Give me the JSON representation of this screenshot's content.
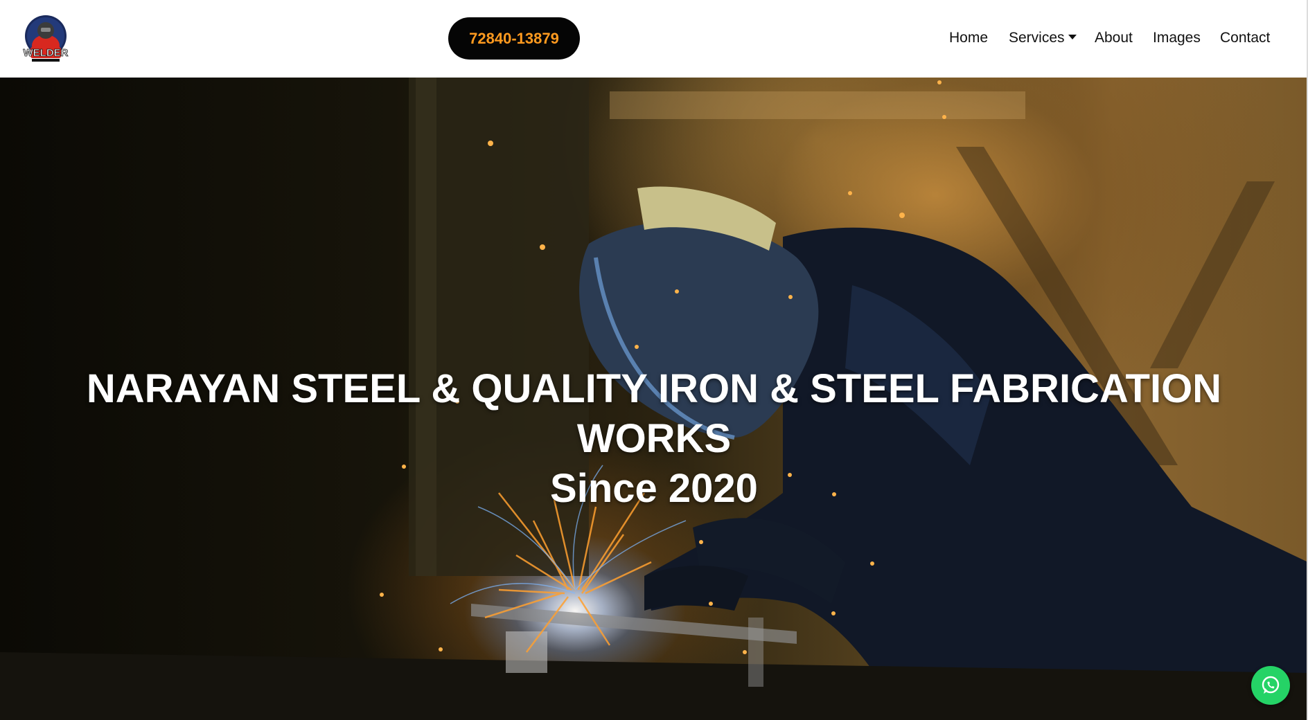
{
  "header": {
    "logo_icon": "welder-mascot-logo",
    "logo_text": "WELDER",
    "phone": "72840-13879",
    "phone_color": "#ff9a1f",
    "nav": {
      "home": "Home",
      "services": "Services",
      "about": "About",
      "images": "Images",
      "contact": "Contact"
    }
  },
  "hero": {
    "title_line1": "NARAYAN STEEL & QUALITY IRON & STEEL FABRICATION",
    "title_line2": "WORKS",
    "title_line3": "Since 2020",
    "background_image": "welder-at-work-with-sparks"
  },
  "floating": {
    "whatsapp_icon": "whatsapp-icon",
    "whatsapp_color": "#25d366"
  }
}
